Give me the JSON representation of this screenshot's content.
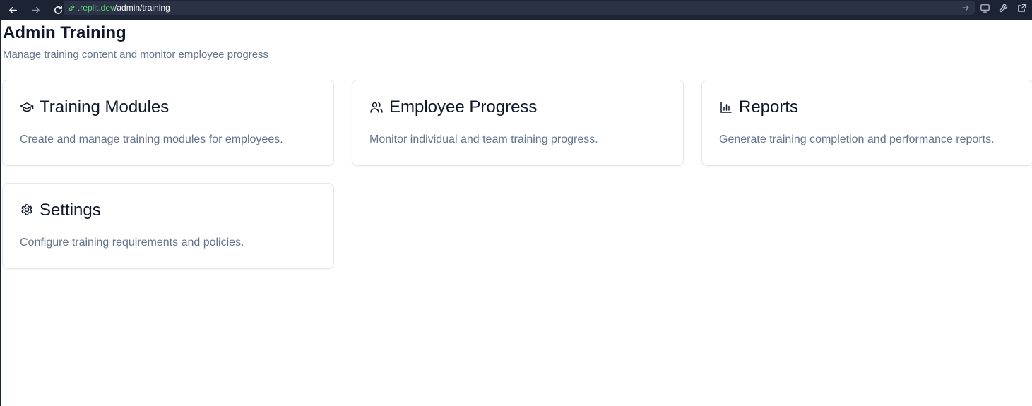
{
  "browser": {
    "url_host": ".replit.dev",
    "url_path": "/admin/training",
    "icons": [
      "back-arrow-icon",
      "forward-arrow-icon",
      "reload-icon",
      "link-icon",
      "go-arrow-icon",
      "monitor-icon",
      "wrench-icon",
      "external-link-icon"
    ]
  },
  "page": {
    "title": "Admin Training",
    "subtitle": "Manage training content and monitor employee progress"
  },
  "cards": [
    {
      "icon": "graduation-cap-icon",
      "title": "Training Modules",
      "description": "Create and manage training modules for employees."
    },
    {
      "icon": "users-icon",
      "title": "Employee Progress",
      "description": "Monitor individual and team training progress."
    },
    {
      "icon": "bar-chart-icon",
      "title": "Reports",
      "description": "Generate training completion and performance reports."
    },
    {
      "icon": "gear-icon",
      "title": "Settings",
      "description": "Configure training requirements and policies."
    }
  ],
  "colors": {
    "topbar_bg": "#1c2333",
    "url_host": "#5fd47a",
    "title": "#0f172a",
    "muted_text": "#64748b",
    "card_border": "#e2e8f0"
  }
}
